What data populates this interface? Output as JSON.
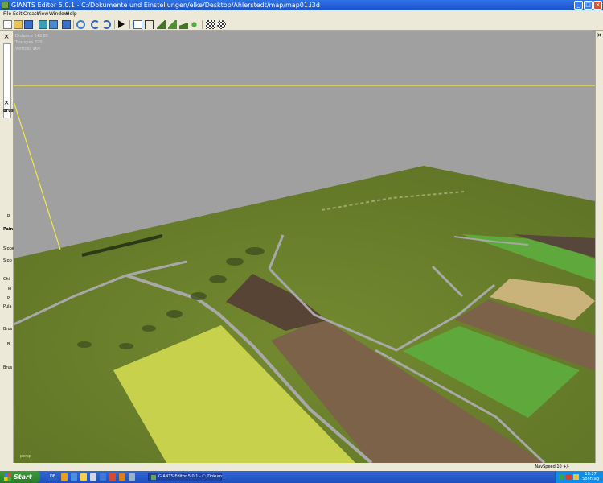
{
  "window": {
    "title": "GIANTS Editor 5.0.1 - C:/Dokumente und Einstellungen/elke/Desktop/Ahlerstedt/map/map01.i3d"
  },
  "menu": {
    "items": [
      "File",
      "Edit",
      "Create",
      "View",
      "Window",
      "Help"
    ]
  },
  "toolbar": {
    "buttons": [
      "new-icon",
      "open-icon",
      "save-icon",
      "import-icon",
      "export-icon",
      "save-as-icon",
      "refresh-icon",
      "undo-icon",
      "redo-icon",
      "play-icon",
      "home-icon",
      "select-icon",
      "terrain-raise-icon",
      "terrain-paint-icon",
      "terrain-smooth-icon",
      "foliage-icon",
      "checker-icon",
      "checker-flag-icon"
    ]
  },
  "left_panel": {
    "labels": [
      "Brus",
      "R",
      "Pain",
      "Slope",
      "Slop",
      "Chi",
      "To",
      "P",
      "Pula",
      "Brus",
      "B",
      "Brus"
    ]
  },
  "viewport": {
    "stats": {
      "distance": "Distance 542.85",
      "triangles": "Triangles 320",
      "vertices": "Vertices 984"
    },
    "camera_label": "persp",
    "colors": {
      "background": "#a0a0a0",
      "terrain_grass": "#6b7f2c",
      "field_brown": "#7b6248",
      "field_yellow": "#c8d14c",
      "field_green": "#5fa83c",
      "field_tan": "#c9b37a",
      "road": "#a8a8a8",
      "selection_line": "#f2e84a"
    }
  },
  "status_bar": {
    "nav_speed": "NavSpeed 10 +/-"
  },
  "taskbar": {
    "start_label": "Start",
    "language": "DE",
    "task_label": "GIANTS Editor 5.0.1 - C:/Dokum...",
    "clock_time": "18:27",
    "clock_day": "Sonntag"
  }
}
